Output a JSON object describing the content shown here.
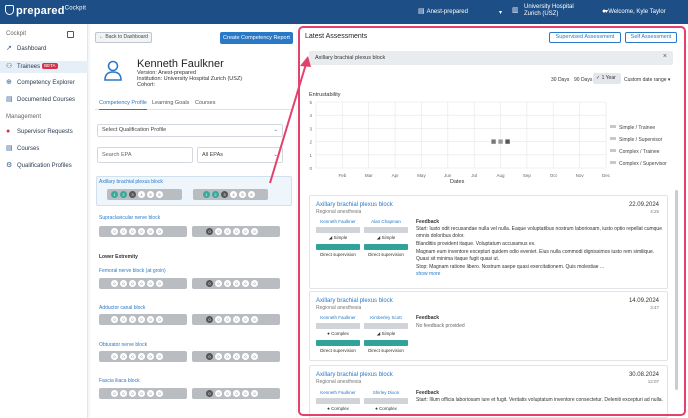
{
  "topbar": {
    "brand": "prepared",
    "brand_sup": "Cockpit",
    "curriculum": "Anest-prepared",
    "institution": "University Hospital Zurich (USZ)",
    "welcome": "Welcome, Kyle Taylor"
  },
  "sidebar": {
    "heading": "Cockpit",
    "items": [
      {
        "label": "Dashboard",
        "icon": "chart-icon"
      },
      {
        "label": "Trainees",
        "icon": "people-icon",
        "badge": "BETA"
      },
      {
        "label": "Competency Explorer",
        "icon": "compass-icon"
      },
      {
        "label": "Documented Courses",
        "icon": "book-icon"
      }
    ],
    "management": "Management",
    "mgmt_items": [
      {
        "label": "Supervisor Requests",
        "icon": "request-icon"
      },
      {
        "label": "Courses",
        "icon": "course-icon"
      },
      {
        "label": "Qualification Profiles",
        "icon": "profile-icon"
      }
    ]
  },
  "profile": {
    "back": "Back to Dashboard",
    "create": "Create Competency Report",
    "name": "Kenneth Faulkner",
    "version": "Version: Anest-prepared",
    "institution": "Institution: University Hospital Zurich (USZ)",
    "cohort": "Cohort:",
    "tabs": [
      "Competency Profile",
      "Learning Goals",
      "Courses"
    ],
    "qual_select": "Select Qualification Profile",
    "search_placeholder": "Search EPA",
    "epa_filter": "All EPAs",
    "epas": [
      {
        "title": "Axillary brachial plexus block",
        "a": [
          "1",
          "2",
          "3",
          "4",
          "5",
          "6"
        ],
        "b": [
          "1",
          "2",
          "3",
          "4",
          "5",
          "6"
        ]
      },
      {
        "title": "Supraclavicular nerve block",
        "a": [
          "0",
          "0",
          "0",
          "0",
          "0",
          "0"
        ],
        "b": [
          "0",
          "0",
          "0",
          "0",
          "0",
          "0"
        ]
      }
    ],
    "section_lower": "Lower Extremity",
    "epas_lower": [
      {
        "title": "Femoral nerve block (at groin)"
      },
      {
        "title": "Adductor canal block"
      },
      {
        "title": "Obturator nerve block"
      },
      {
        "title": "Fascia iliaca block"
      }
    ]
  },
  "assessments": {
    "title": "Latest Assessments",
    "btn_supervised": "Supervised Assessment",
    "btn_self": "Self Assessment",
    "filter": "Axillary brachial plexus block",
    "ranges": [
      "30 Days",
      "90 Days",
      "1 Year",
      "Custom date range"
    ],
    "active_range": "1 Year",
    "chart_data": {
      "type": "scatter",
      "ylabel": "Entrustability",
      "xlabel": "Dates",
      "categories": [
        "Feb",
        "Mar",
        "Apr",
        "May",
        "Jun",
        "Jul",
        "Aug",
        "Sep",
        "Oct",
        "Nov",
        "Dec"
      ],
      "ylim": [
        0,
        5
      ],
      "yticks": [
        "5",
        "4",
        "3",
        "2",
        "1",
        "0"
      ],
      "legend": [
        "Simple / Trainee",
        "Simple / Supervisor",
        "Complex / Trainee",
        "Complex / Supervisor"
      ],
      "legend_position": "right",
      "series": [
        {
          "name": "Simple / Trainee",
          "x": [
            "Aug"
          ],
          "y": [
            2
          ]
        },
        {
          "name": "Simple / Supervisor",
          "x": [
            "Aug"
          ],
          "y": [
            2
          ]
        },
        {
          "name": "Complex / Trainee",
          "x": [
            "Aug"
          ],
          "y": [
            2
          ]
        }
      ]
    },
    "cards": [
      {
        "title": "Axillary brachial plexus block",
        "subtitle": "Regional anesthesia",
        "date": "22.09.2024",
        "time": "4:25",
        "trainee": "Kenneth Faulkner",
        "supervisor": "Alan Chapman",
        "t_complexity": "Simple",
        "s_complexity": "Simple",
        "t_level": "Direct supervision",
        "s_level": "Direct supervision",
        "feedback_label": "Feedback",
        "start": "Start: Iusto odit recusandae nulla vel nulla. Eaque voluptatibus nostrum laboriosam, iusto optio repellat cumque omnis doloribus dolor.",
        "cont": "Blanditiis provident itaque. Voluptatum accusamus ex.",
        "cont2": "Magnam eum inventore excepturi quidem odio eveniet. Eius nulla commodi dignissimos iusto rem similique. Quasi sit minima itaque fugit quasi ut.",
        "stop": "Stop: Magnam ratione libero. Nostrum saepe quasi exercitationem. Quis molestiae ...",
        "more": "show more"
      },
      {
        "title": "Axillary brachial plexus block",
        "subtitle": "Regional anesthesia",
        "date": "14.09.2024",
        "time": "3:47",
        "trainee": "Kenneth Faulkner",
        "supervisor": "Kimberley Scott",
        "t_complexity": "Complex",
        "s_complexity": "Simple",
        "t_level": "Direct supervision",
        "s_level": "Direct supervision",
        "feedback_label": "Feedback",
        "start": "No feedback provided"
      },
      {
        "title": "Axillary brachial plexus block",
        "subtitle": "Regional anesthesia",
        "date": "30.08.2024",
        "time": "12:07",
        "trainee": "Kenneth Faulkner",
        "supervisor": "Shirley Dixon",
        "t_complexity": "Complex",
        "s_complexity": "Complex",
        "feedback_label": "Feedback",
        "start": "Start: Illum officia laboriosam iure et fugit. Veritatis voluptatum inventore consectetur. Deleniti excepturi ad nulla."
      }
    ]
  }
}
